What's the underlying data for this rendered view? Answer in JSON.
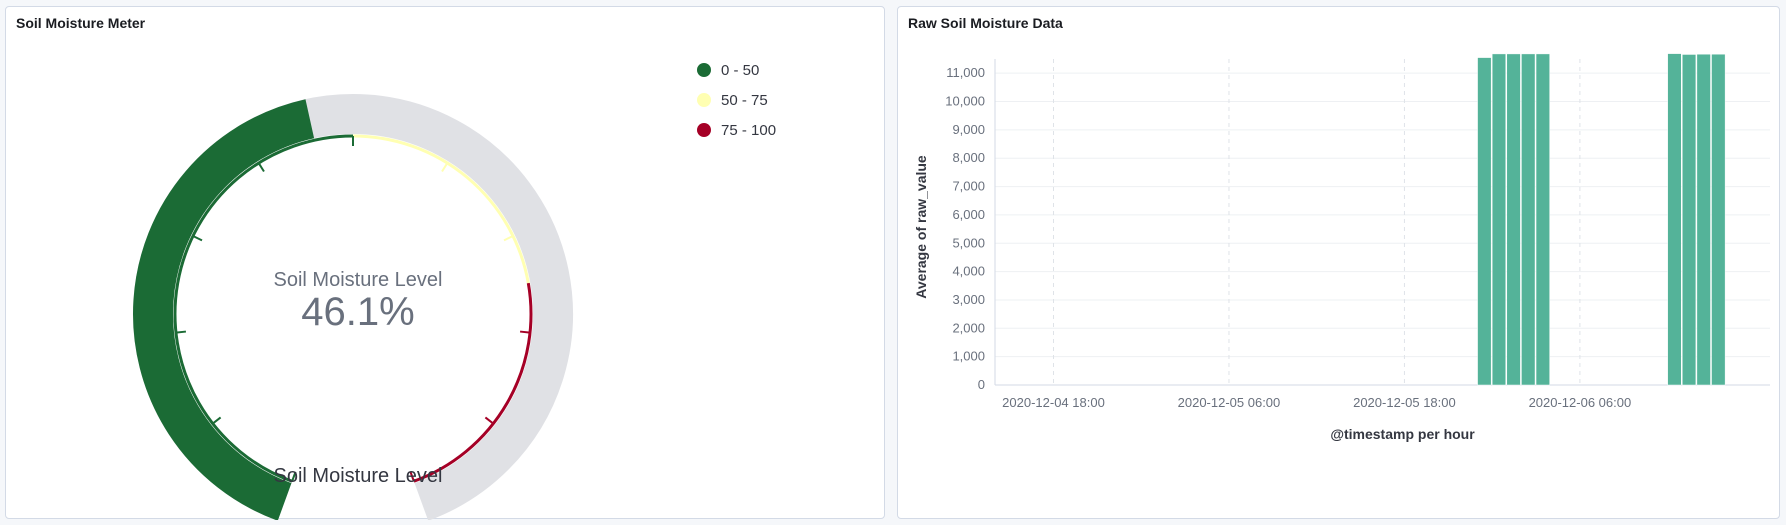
{
  "left_panel": {
    "title": "Soil Moisture Meter",
    "gauge": {
      "center_label": "Soil Moisture Level",
      "value_text": "46.1%",
      "value": 46.1,
      "min": 0,
      "max": 100,
      "bottom_label": "Soil Moisture Level",
      "fill_color": "#1b6b35",
      "track_color": "#e0e1e5"
    },
    "legend": [
      {
        "label": "0 - 50",
        "color": "#1b6b35"
      },
      {
        "label": "50 - 75",
        "color": "#ffffb2"
      },
      {
        "label": "75 - 100",
        "color": "#a50026"
      }
    ]
  },
  "right_panel": {
    "title": "Raw Soil Moisture Data"
  },
  "chart_data": {
    "type": "bar",
    "title": "Raw Soil Moisture Data",
    "xlabel": "@timestamp per hour",
    "ylabel": "Average of raw_value",
    "ylim": [
      0,
      11500
    ],
    "yticks": [
      0,
      1000,
      2000,
      3000,
      4000,
      5000,
      6000,
      7000,
      8000,
      9000,
      10000,
      11000
    ],
    "ytick_labels": [
      "0",
      "1,000",
      "2,000",
      "3,000",
      "4,000",
      "5,000",
      "6,000",
      "7,000",
      "8,000",
      "9,000",
      "10,000",
      "11,000"
    ],
    "xticks": [
      "2020-12-04 18:00",
      "2020-12-05 06:00",
      "2020-12-05 18:00",
      "2020-12-06 06:00"
    ],
    "bar_color": "#54b399",
    "grid": true,
    "bars": [
      {
        "x": "2020-12-05 23:00",
        "value": 11550
      },
      {
        "x": "2020-12-06 00:00",
        "value": 11680
      },
      {
        "x": "2020-12-06 01:00",
        "value": 11680
      },
      {
        "x": "2020-12-06 02:00",
        "value": 11680
      },
      {
        "x": "2020-12-06 03:00",
        "value": 11680
      },
      {
        "x": "2020-12-06 12:00",
        "value": 11690
      },
      {
        "x": "2020-12-06 13:00",
        "value": 11660
      },
      {
        "x": "2020-12-06 14:00",
        "value": 11670
      },
      {
        "x": "2020-12-06 15:00",
        "value": 11670
      }
    ]
  }
}
